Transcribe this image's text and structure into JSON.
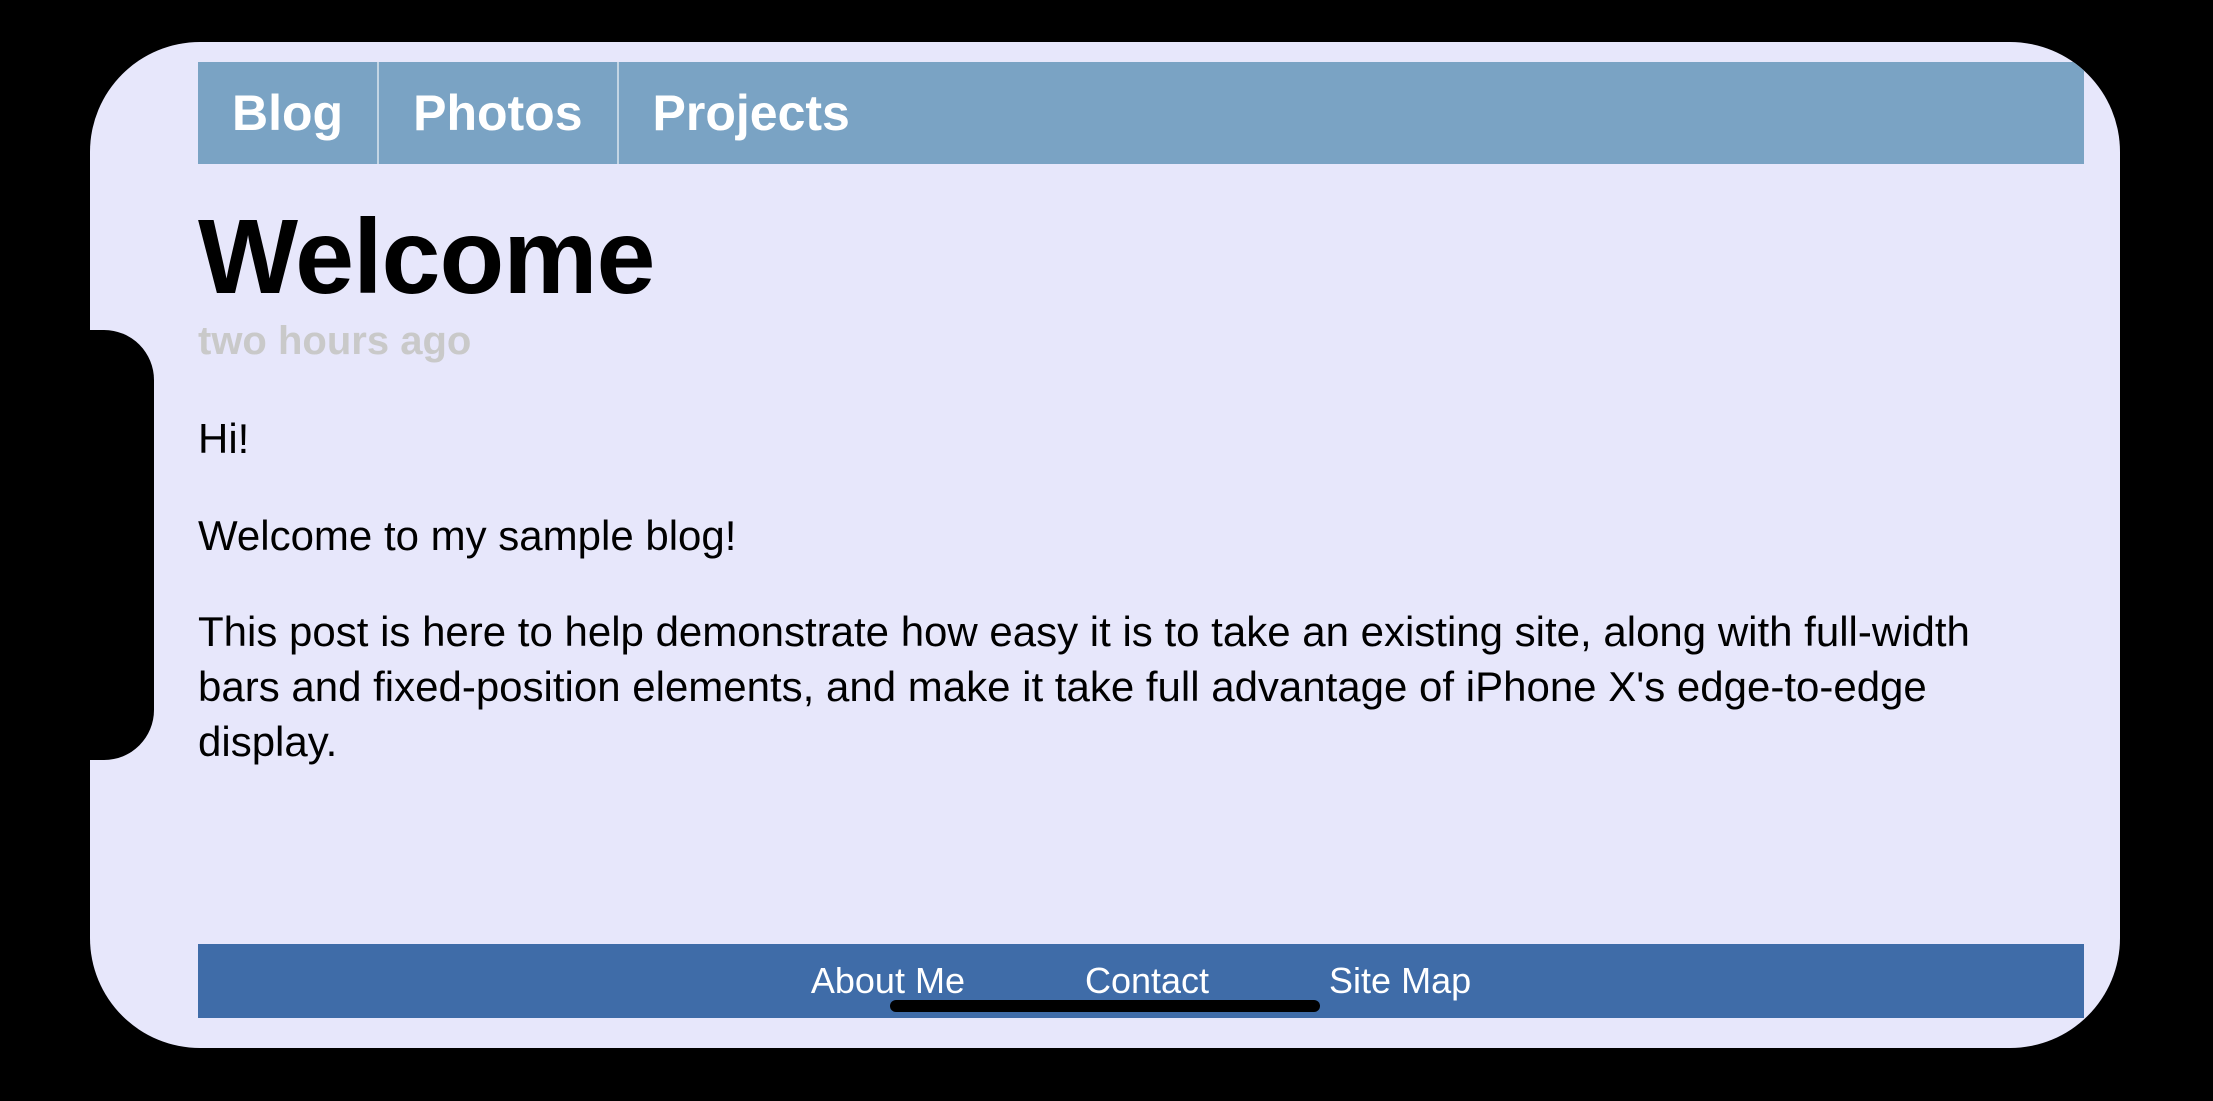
{
  "nav": {
    "tabs": [
      {
        "label": "Blog"
      },
      {
        "label": "Photos"
      },
      {
        "label": "Projects"
      }
    ]
  },
  "post": {
    "title": "Welcome",
    "timestamp": "two hours ago",
    "paragraphs": [
      "Hi!",
      "Welcome to my sample blog!",
      "This post is here to help demonstrate how easy it is to take an existing site, along with full-width bars and fixed-position elements, and make it take full advantage of iPhone X's edge-to-edge display."
    ]
  },
  "footer": {
    "links": [
      {
        "label": "About Me"
      },
      {
        "label": "Contact"
      },
      {
        "label": "Site Map"
      }
    ]
  }
}
